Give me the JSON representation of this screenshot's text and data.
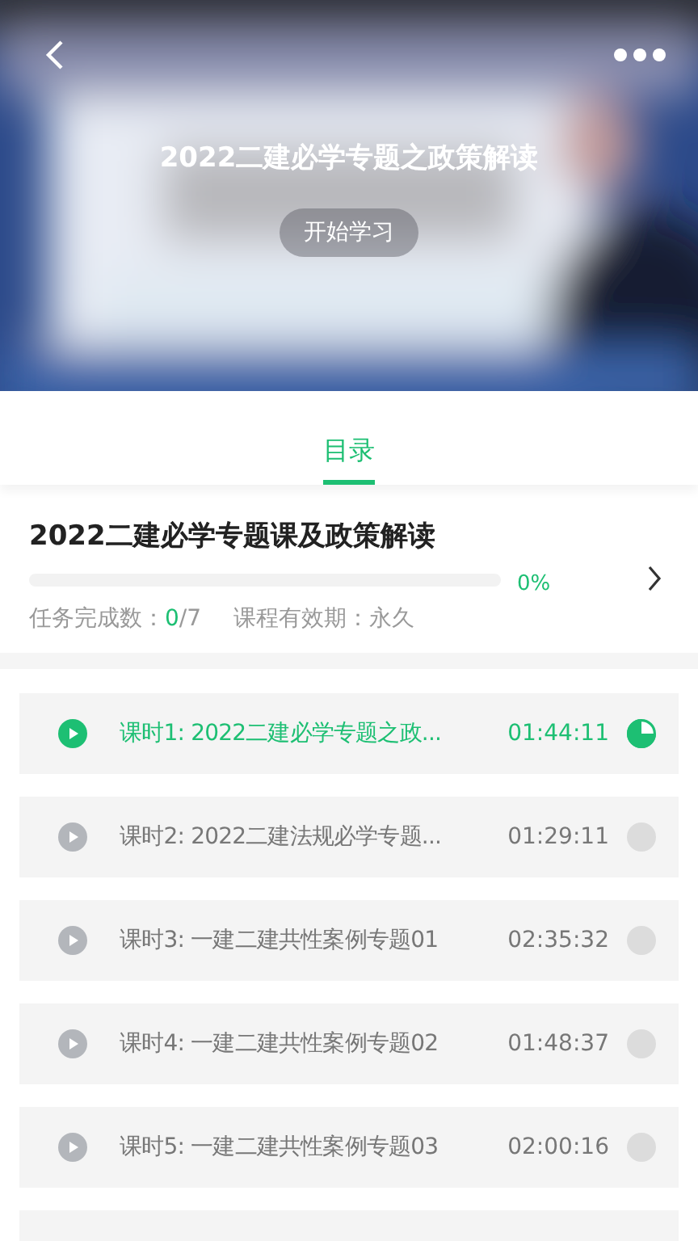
{
  "header": {
    "title": "2022二建必学专题之政策解读",
    "start_button": "开始学习"
  },
  "tabs": [
    {
      "label": "目录",
      "selected": true
    }
  ],
  "course": {
    "title": "2022二建必学专题课及政策解读",
    "progress": {
      "level": 0,
      "reading": "0%"
    },
    "tasks_label": "任务完成数：",
    "tasks_done": "0",
    "tasks_total": "/7",
    "validity": "课程有效期：永久"
  },
  "lessons": [
    {
      "title": "课时1: 2022二建必学专题之政...",
      "duration": "01:44:11",
      "selected": true,
      "started": true
    },
    {
      "title": "课时2: 2022二建法规必学专题...",
      "duration": "01:29:11",
      "selected": false,
      "started": false
    },
    {
      "title": "课时3: 一建二建共性案例专题01",
      "duration": "02:35:32",
      "selected": false,
      "started": false
    },
    {
      "title": "课时4: 一建二建共性案例专题02",
      "duration": "01:48:37",
      "selected": false,
      "started": false
    },
    {
      "title": "课时5: 一建二建共性案例专题03",
      "duration": "02:00:16",
      "selected": false,
      "started": false
    }
  ]
}
